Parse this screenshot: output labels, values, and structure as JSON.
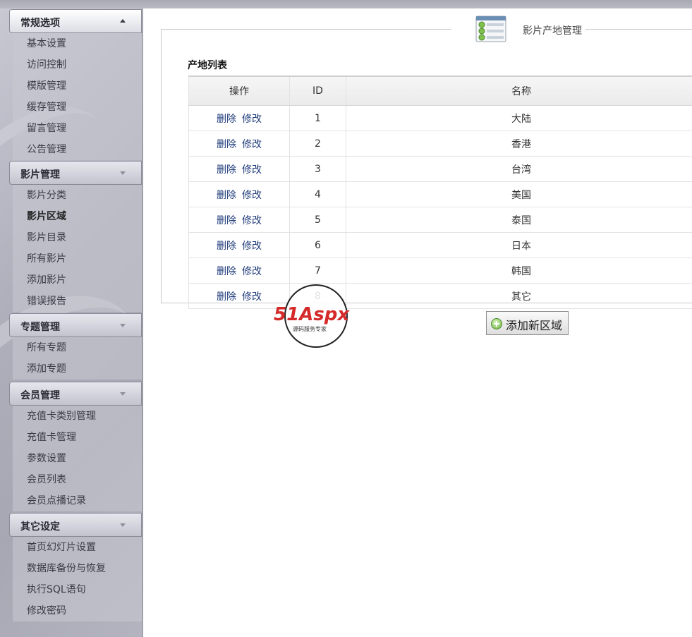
{
  "sidebar": {
    "sections": [
      {
        "title": "常规选项",
        "expanded": true,
        "items": [
          "基本设置",
          "访问控制",
          "模版管理",
          "缓存管理",
          "留言管理",
          "公告管理"
        ]
      },
      {
        "title": "影片管理",
        "expanded": false,
        "items": [
          "影片分类",
          "影片区域",
          "影片目录",
          "所有影片",
          "添加影片",
          "错误报告"
        ]
      },
      {
        "title": "专题管理",
        "expanded": false,
        "items": [
          "所有专题",
          "添加专题"
        ]
      },
      {
        "title": "会员管理",
        "expanded": false,
        "items": [
          "充值卡类别管理",
          "充值卡管理",
          "参数设置",
          "会员列表",
          "会员点播记录"
        ]
      },
      {
        "title": "其它设定",
        "expanded": false,
        "items": [
          "首页幻灯片设置",
          "数据库备份与恢复",
          "执行SQL语句",
          "修改密码"
        ]
      }
    ],
    "current_item": "影片区域"
  },
  "main": {
    "panel_title": "影片产地管理",
    "list_title": "产地列表",
    "columns": [
      "操作",
      "ID",
      "名称"
    ],
    "row_actions": {
      "delete": "删除",
      "edit": "修改"
    },
    "rows": [
      {
        "id": "1",
        "name": "大陆"
      },
      {
        "id": "2",
        "name": "香港"
      },
      {
        "id": "3",
        "name": "台湾"
      },
      {
        "id": "4",
        "name": "美国"
      },
      {
        "id": "5",
        "name": "泰国"
      },
      {
        "id": "6",
        "name": "日本"
      },
      {
        "id": "7",
        "name": "韩国"
      },
      {
        "id": "8",
        "name": "其它"
      }
    ],
    "add_button": "添加新区域"
  },
  "watermark": {
    "brand": "51Aspx",
    "tagline": "源码服务专家"
  },
  "colors": {
    "link": "#1f3b7a",
    "sidebar_bg": "#aeafbb",
    "brand_red": "#d42a2a",
    "brand_green": "#2e9a3a"
  }
}
